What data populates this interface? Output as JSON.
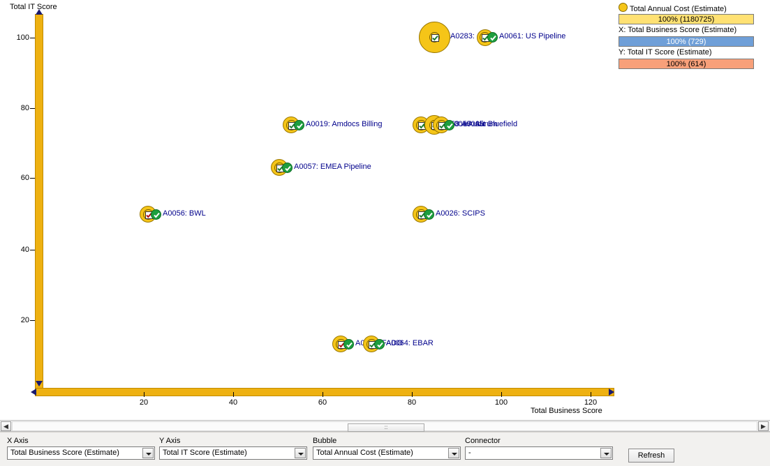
{
  "chart_data": {
    "type": "scatter",
    "title": "",
    "xlabel": "Total Business Score",
    "ylabel": "Total IT Score",
    "xlim": [
      0,
      130
    ],
    "ylim": [
      0,
      107
    ],
    "xticks": [
      20,
      40,
      60,
      80,
      100,
      120
    ],
    "yticks": [
      20,
      40,
      60,
      80,
      100
    ],
    "grid": false,
    "bubble_variable": "Total Annual Cost (Estimate)",
    "points": [
      {
        "label": "A0283: eCare",
        "x": 87,
        "y": 100,
        "bubble": 40
      },
      {
        "label": "A0061: US Pipeline",
        "x": 100,
        "y": 100,
        "bubble": 15
      },
      {
        "label": "A0019: Amdocs Billing",
        "x": 60,
        "y": 75,
        "bubble": 15
      },
      {
        "label": "A0058: eAudit",
        "x": 87,
        "y": 75,
        "bubble": 15
      },
      {
        "label": "A0055: Aurum",
        "x": 90,
        "y": 75,
        "bubble": 19
      },
      {
        "label": "A0065: Bluefield",
        "x": 92,
        "y": 75,
        "bubble": 15
      },
      {
        "label": "A0057: EMEA Pipeline",
        "x": 52,
        "y": 63,
        "bubble": 15
      },
      {
        "label": "A0056: BWL",
        "x": 25,
        "y": 51,
        "bubble": 15
      },
      {
        "label": "A0026: SCIPS",
        "x": 87,
        "y": 51,
        "bubble": 15
      },
      {
        "label": "A0048: FADO",
        "x": 68,
        "y": 14,
        "bubble": 15
      },
      {
        "label": "A0064: EBAR",
        "x": 75,
        "y": 14,
        "bubble": 15
      }
    ]
  },
  "legend": {
    "bubble_title": "Total Annual Cost (Estimate)",
    "bubble_value": "100% (1180725)",
    "x_title": "X: Total Business Score (Estimate)",
    "x_value": "100% (729)",
    "y_title": "Y: Total IT Score (Estimate)",
    "y_value": "100% (614)",
    "colors": {
      "bubble": "#ffe173",
      "x": "#6f9fd8",
      "y": "#f8a07a",
      "axis": "#eeb111",
      "label": "#00008b"
    }
  },
  "scrollbar": {
    "left_arrow": "◀",
    "right_arrow": "▶",
    "thumb_grip": "∶∶"
  },
  "controls": {
    "x_axis": {
      "label": "X Axis",
      "value": "Total Business Score (Estimate)"
    },
    "y_axis": {
      "label": "Y Axis",
      "value": "Total IT Score (Estimate)"
    },
    "bubble": {
      "label": "Bubble",
      "value": "Total Annual Cost (Estimate)"
    },
    "connector": {
      "label": "Connector",
      "value": "-"
    },
    "refresh": {
      "label": "Refresh"
    }
  }
}
